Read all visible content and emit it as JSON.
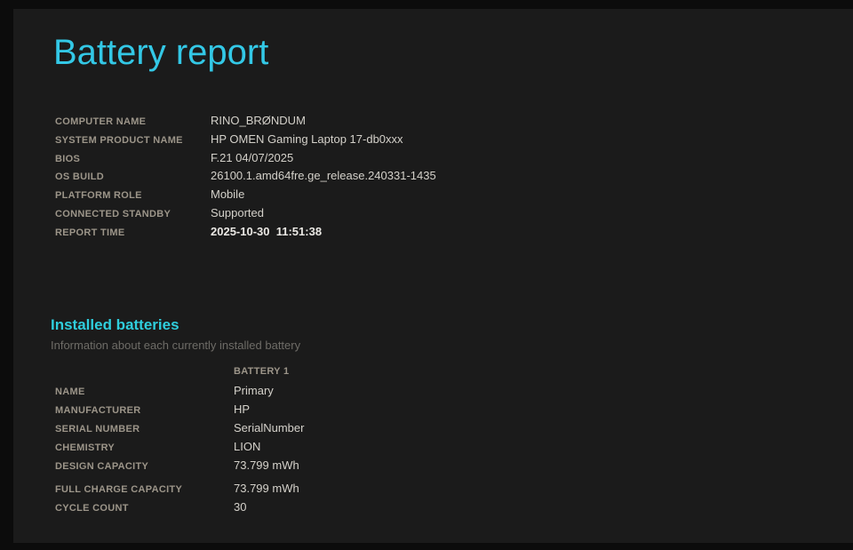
{
  "accent_color": "#33c8e6",
  "page": {
    "title": "Battery report"
  },
  "system_info": {
    "rows": [
      {
        "label": "COMPUTER NAME",
        "value": "RINO_BRØNDUM"
      },
      {
        "label": "SYSTEM PRODUCT NAME",
        "value": "HP OMEN Gaming Laptop 17-db0xxx"
      },
      {
        "label": "BIOS",
        "value": "F.21 04/07/2025"
      },
      {
        "label": "OS BUILD",
        "value": "26100.1.amd64fre.ge_release.240331-1435"
      },
      {
        "label": "PLATFORM ROLE",
        "value": "Mobile"
      },
      {
        "label": "CONNECTED STANDBY",
        "value": "Supported"
      },
      {
        "label": "REPORT TIME",
        "value": "2025-10-30  11:51:38"
      }
    ]
  },
  "installed_batteries": {
    "heading": "Installed batteries",
    "subtitle": "Information about each currently installed battery",
    "column_header": "BATTERY 1",
    "rows": [
      {
        "label": "NAME",
        "value": "Primary"
      },
      {
        "label": "MANUFACTURER",
        "value": "HP"
      },
      {
        "label": "SERIAL NUMBER",
        "value": "SerialNumber"
      },
      {
        "label": "CHEMISTRY",
        "value": "LION"
      },
      {
        "label": "DESIGN CAPACITY",
        "value": "73.799 mWh"
      },
      {
        "label": "FULL CHARGE CAPACITY",
        "value": "73.799 mWh"
      },
      {
        "label": "CYCLE COUNT",
        "value": "30"
      }
    ]
  }
}
